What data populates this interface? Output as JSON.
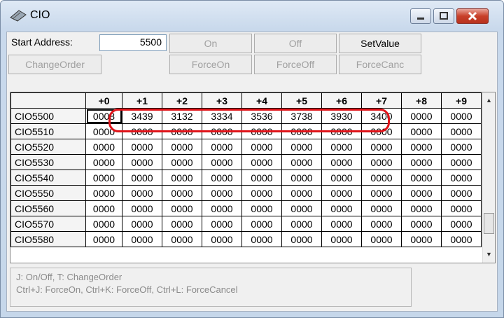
{
  "window": {
    "title": "CIO",
    "icon": "chip-icon"
  },
  "toolbar": {
    "start_address_label": "Start Address:",
    "start_address_value": "5500",
    "on_label": "On",
    "off_label": "Off",
    "setvalue_label": "SetValue",
    "changeorder_label": "ChangeOrder",
    "forceon_label": "ForceOn",
    "forceoff_label": "ForceOff",
    "forcecanc_label": "ForceCanc"
  },
  "grid": {
    "columns": [
      "+0",
      "+1",
      "+2",
      "+3",
      "+4",
      "+5",
      "+6",
      "+7",
      "+8",
      "+9"
    ],
    "rows": [
      {
        "label": "CIO5500",
        "values": [
          "0008",
          "3439",
          "3132",
          "3334",
          "3536",
          "3738",
          "3930",
          "3400",
          "0000",
          "0000"
        ]
      },
      {
        "label": "CIO5510",
        "values": [
          "0000",
          "0000",
          "0000",
          "0000",
          "0000",
          "0000",
          "0000",
          "0000",
          "0000",
          "0000"
        ]
      },
      {
        "label": "CIO5520",
        "values": [
          "0000",
          "0000",
          "0000",
          "0000",
          "0000",
          "0000",
          "0000",
          "0000",
          "0000",
          "0000"
        ]
      },
      {
        "label": "CIO5530",
        "values": [
          "0000",
          "0000",
          "0000",
          "0000",
          "0000",
          "0000",
          "0000",
          "0000",
          "0000",
          "0000"
        ]
      },
      {
        "label": "CIO5540",
        "values": [
          "0000",
          "0000",
          "0000",
          "0000",
          "0000",
          "0000",
          "0000",
          "0000",
          "0000",
          "0000"
        ]
      },
      {
        "label": "CIO5550",
        "values": [
          "0000",
          "0000",
          "0000",
          "0000",
          "0000",
          "0000",
          "0000",
          "0000",
          "0000",
          "0000"
        ]
      },
      {
        "label": "CIO5560",
        "values": [
          "0000",
          "0000",
          "0000",
          "0000",
          "0000",
          "0000",
          "0000",
          "0000",
          "0000",
          "0000"
        ]
      },
      {
        "label": "CIO5570",
        "values": [
          "0000",
          "0000",
          "0000",
          "0000",
          "0000",
          "0000",
          "0000",
          "0000",
          "0000",
          "0000"
        ]
      },
      {
        "label": "CIO5580",
        "values": [
          "0000",
          "0000",
          "0000",
          "0000",
          "0000",
          "0000",
          "0000",
          "0000",
          "0000",
          "0000"
        ]
      }
    ]
  },
  "hint": {
    "line1": "J: On/Off,   T: ChangeOrder",
    "line2": "Ctrl+J: ForceOn,   Ctrl+K: ForceOff,   Ctrl+L: ForceCancel"
  },
  "colors": {
    "highlight": "#e0141a",
    "close_button": "#c8402a"
  }
}
